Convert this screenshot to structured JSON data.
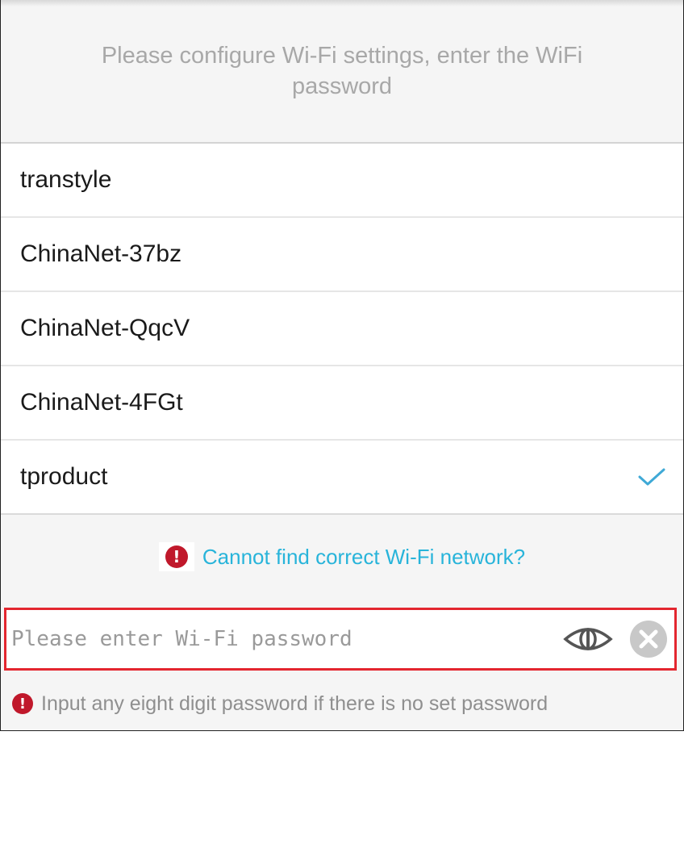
{
  "header": {
    "instruction": "Please configure Wi-Fi settings, enter the WiFi password"
  },
  "wifi_networks": [
    {
      "name": "transtyle",
      "selected": false
    },
    {
      "name": "ChinaNet-37bz",
      "selected": false
    },
    {
      "name": "ChinaNet-QqcV",
      "selected": false
    },
    {
      "name": "ChinaNet-4FGt",
      "selected": false
    },
    {
      "name": "tproduct",
      "selected": true
    }
  ],
  "help": {
    "link_text": "Cannot find correct Wi-Fi network?",
    "icon": "alert-icon"
  },
  "password": {
    "placeholder": "Please enter Wi-Fi password",
    "value": "",
    "show_icon": "eye-icon",
    "clear_icon": "clear-icon"
  },
  "hint": {
    "text": "Input any eight digit password if there is no set password",
    "icon": "alert-icon"
  },
  "colors": {
    "accent": "#28b4da",
    "alert": "#c0182b",
    "highlight_border": "#e3262f",
    "check": "#3fa9d6"
  }
}
